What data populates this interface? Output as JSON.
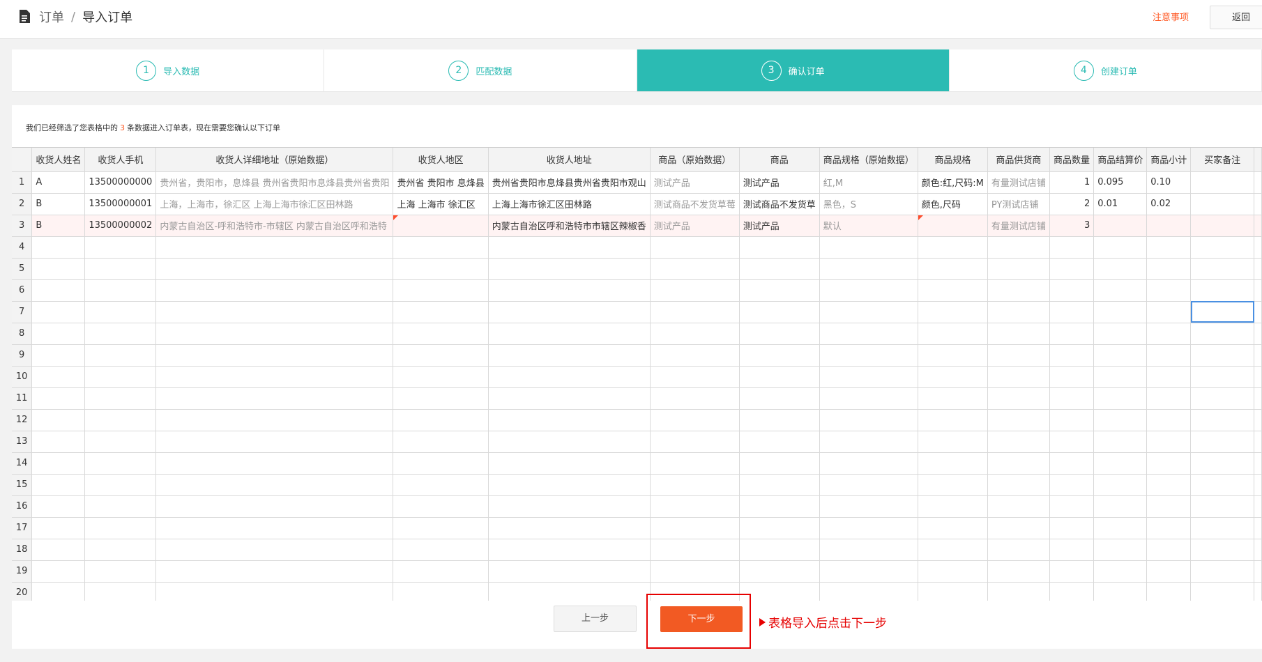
{
  "header": {
    "breadcrumb": [
      "订单",
      "/",
      "导入订单"
    ],
    "notice_link": "注意事项",
    "back_button": "返回"
  },
  "steps": [
    {
      "num": "1",
      "label": "导入数据",
      "active": false
    },
    {
      "num": "2",
      "label": "匹配数据",
      "active": false
    },
    {
      "num": "3",
      "label": "确认订单",
      "active": true
    },
    {
      "num": "4",
      "label": "创建订单",
      "active": false
    }
  ],
  "info": {
    "prefix": "我们已经筛选了您表格中的",
    "count": "3",
    "suffix": "条数据进入订单表，现在需要您确认以下订单"
  },
  "table": {
    "columns": [
      "收货人姓名",
      "收货人手机",
      "收货人详细地址（原始数据）",
      "收货人地区",
      "收货人地址",
      "商品（原始数据）",
      "商品",
      "商品规格（原始数据）",
      "商品规格",
      "商品供货商",
      "商品数量",
      "商品结算价",
      "商品小计",
      "买家备注"
    ],
    "rows": [
      [
        "A",
        "13500000000",
        "贵州省，贵阳市，息烽县 贵州省贵阳市息烽县贵州省贵阳",
        "贵州省 贵阳市 息烽县",
        "贵州省贵阳市息烽县贵州省贵阳市观山",
        "测试产品",
        "测试产品",
        "红,M",
        "颜色:红,尺码:M",
        "有量测试店铺",
        "1",
        "0.095",
        "0.10",
        ""
      ],
      [
        "B",
        "13500000001",
        "上海，上海市，徐汇区 上海上海市徐汇区田林路",
        "上海 上海市 徐汇区",
        "上海上海市徐汇区田林路",
        "测试商品不发货草莓",
        "测试商品不发货草",
        "黑色，S",
        "颜色,尺码",
        "PY测试店铺",
        "2",
        "0.01",
        "0.02",
        ""
      ],
      [
        "B",
        "13500000002",
        "内蒙古自治区-呼和浩特市-市辖区 内蒙古自治区呼和浩特",
        "",
        "内蒙古自治区呼和浩特市市辖区辣椒香",
        "测试产品",
        "测试产品",
        "默认",
        "",
        "有量测试店铺",
        "3",
        "",
        "",
        ""
      ]
    ],
    "row_numbers": [
      "1",
      "2",
      "3",
      "4",
      "5",
      "6",
      "7",
      "8",
      "9",
      "10",
      "11",
      "12",
      "13",
      "14",
      "15",
      "16",
      "17",
      "18",
      "19",
      "20"
    ]
  },
  "footer": {
    "prev_button": "上一步",
    "next_button": "下一步",
    "hint": "表格导入后点击下一步"
  },
  "colors": {
    "accent": "#2bbbb3",
    "primary_button": "#f25a23",
    "warning_text": "#ff5722",
    "annotation_red": "#e60000"
  }
}
